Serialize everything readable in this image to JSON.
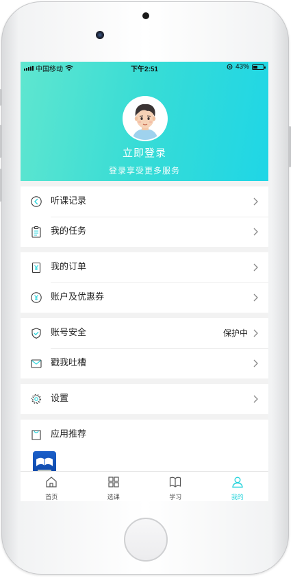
{
  "status_bar": {
    "carrier": "中国移动",
    "time": "下午2:51",
    "battery": "43%",
    "battery_level": 0.43
  },
  "profile": {
    "login_title": "立即登录",
    "login_subtitle": "登录享受更多服务"
  },
  "menu_groups": [
    {
      "items": [
        {
          "label": "听课记录",
          "icon": "history-icon"
        },
        {
          "label": "我的任务",
          "icon": "clipboard-icon"
        }
      ]
    },
    {
      "items": [
        {
          "label": "我的订单",
          "icon": "order-icon"
        },
        {
          "label": "账户及优惠券",
          "icon": "coupon-icon"
        }
      ]
    },
    {
      "items": [
        {
          "label": "账号安全",
          "icon": "shield-icon",
          "extra": "保护中"
        },
        {
          "label": "戳我吐槽",
          "icon": "feedback-icon"
        }
      ]
    },
    {
      "items": [
        {
          "label": "设置",
          "icon": "gear-icon"
        }
      ]
    },
    {
      "items": [
        {
          "label": "应用推荐",
          "icon": "bag-icon"
        }
      ]
    }
  ],
  "tabbar": {
    "tabs": [
      {
        "label": "首页",
        "icon": "home-icon"
      },
      {
        "label": "选课",
        "icon": "grid-icon"
      },
      {
        "label": "学习",
        "icon": "book-icon"
      },
      {
        "label": "我的",
        "icon": "user-icon",
        "active": true
      }
    ]
  },
  "colors": {
    "accent": "#2ad4dc",
    "header_start": "#5fe6cf",
    "header_end": "#1fd6e6"
  }
}
